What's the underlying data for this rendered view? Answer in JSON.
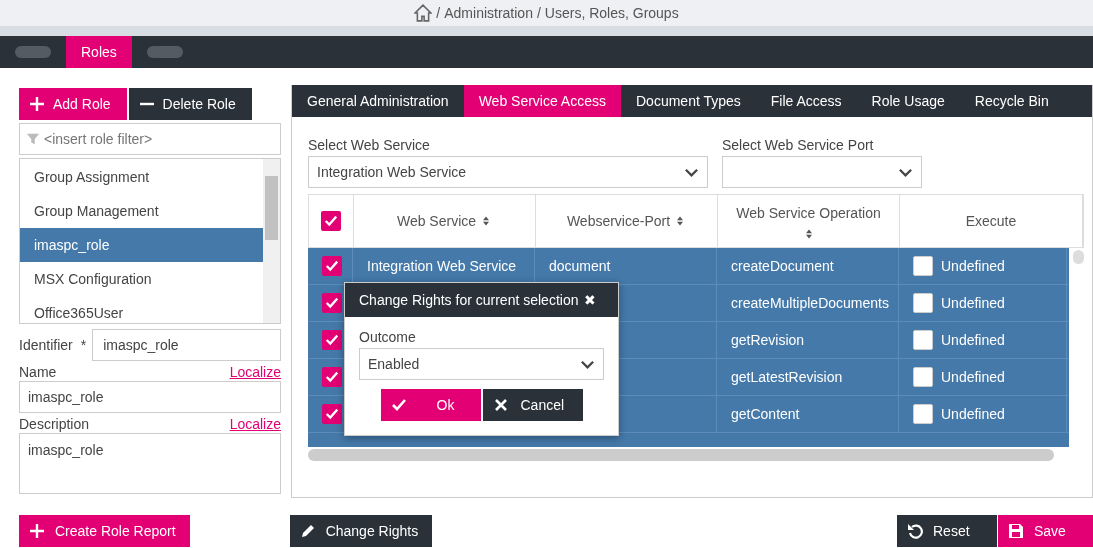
{
  "breadcrumb": [
    "/",
    "Administration",
    "/",
    "Users, Roles, Groups"
  ],
  "main_tabs": [
    {
      "kind": "redacted",
      "selected": false
    },
    {
      "kind": "tab",
      "label": "Roles",
      "selected": true
    },
    {
      "kind": "redacted",
      "selected": false
    }
  ],
  "role_buttons": [
    {
      "label": "Add Role",
      "kind": "add"
    },
    {
      "label": "Delete Role",
      "kind": "delete"
    }
  ],
  "role_filter": {
    "placeholder": "<insert role filter>"
  },
  "roles": [
    {
      "label": "Group Assignment",
      "selected": false
    },
    {
      "label": "Group Management",
      "selected": false
    },
    {
      "label": "imaspc_role",
      "selected": true
    },
    {
      "label": "MSX Configuration",
      "selected": false
    },
    {
      "label": "Office365User",
      "selected": false
    }
  ],
  "identifier": {
    "label": "Identifier",
    "required_mark": "*",
    "value": "imaspc_role"
  },
  "name": {
    "label": "Name",
    "link": "Localize",
    "value": "imaspc_role"
  },
  "description": {
    "label": "Description",
    "link": "Localize",
    "value": "imaspc_role"
  },
  "detail_tabs": [
    {
      "label": "General Administration",
      "selected": false
    },
    {
      "label": "Web Service Access",
      "selected": true
    },
    {
      "label": "Document Types",
      "selected": false
    },
    {
      "label": "File Access",
      "selected": false
    },
    {
      "label": "Role Usage",
      "selected": false
    },
    {
      "label": "Recycle Bin",
      "selected": false
    }
  ],
  "web_service_select": {
    "label": "Select Web Service",
    "value": "Integration Web Service"
  },
  "port_select": {
    "label": "Select Web Service Port"
  },
  "table": {
    "select_all_checked": true,
    "columns": [
      "Web Service",
      "Webservice-Port",
      "Web Service Operation",
      "Execute"
    ],
    "rows": [
      {
        "checked": true,
        "web_service": "Integration Web Service",
        "port": "document",
        "operation": "createDocument",
        "execute_checked": false,
        "execute": "Undefined"
      },
      {
        "checked": true,
        "operation": "createMultipleDocuments",
        "execute_checked": false,
        "execute": "Undefined"
      },
      {
        "checked": true,
        "operation": "getRevision",
        "execute_checked": false,
        "execute": "Undefined"
      },
      {
        "checked": true,
        "operation": "getLatestRevision",
        "execute_checked": false,
        "execute": "Undefined"
      },
      {
        "checked": true,
        "operation": "getContent",
        "execute_checked": false,
        "execute": "Undefined"
      }
    ]
  },
  "dialog": {
    "title": "Change Rights for current selection",
    "close": "✖",
    "field_label": "Outcome",
    "value": "Enabled",
    "buttons": [
      {
        "label": "Ok",
        "kind": "ok"
      },
      {
        "label": "Cancel",
        "kind": "cancel"
      }
    ]
  },
  "footer_buttons": [
    {
      "label": "Create Role Report",
      "kind": "add"
    },
    {
      "label": "Change Rights",
      "kind": "pencil"
    },
    {
      "label": "Reset",
      "kind": "reset"
    },
    {
      "label": "Save",
      "kind": "save"
    }
  ]
}
